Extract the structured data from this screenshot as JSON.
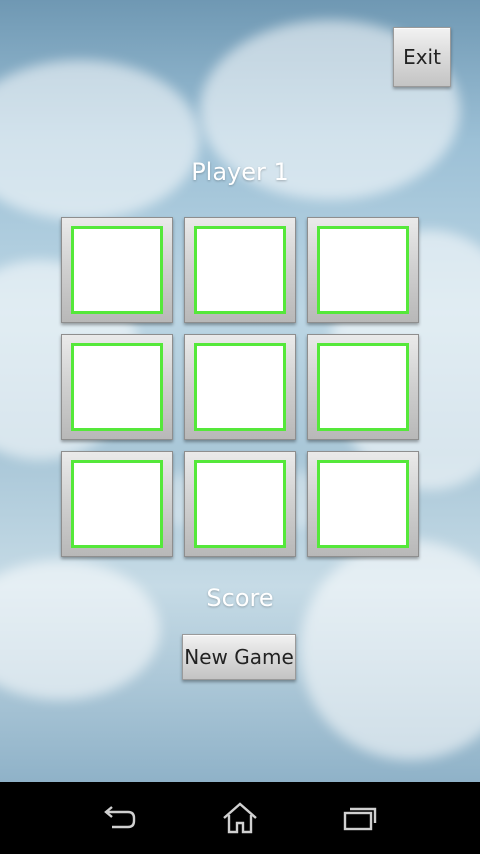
{
  "header": {
    "exit_label": "Exit"
  },
  "game": {
    "player_label": "Player 1",
    "score_label": "Score",
    "board": [
      "",
      "",
      "",
      "",
      "",
      "",
      "",
      "",
      ""
    ]
  },
  "footer": {
    "new_game_label": "New Game"
  },
  "navbar": {
    "back_icon": "back-icon",
    "home_icon": "home-icon",
    "recents_icon": "recent-apps-icon"
  },
  "colors": {
    "cell_border": "#55e83a",
    "navbar": "#000000"
  }
}
